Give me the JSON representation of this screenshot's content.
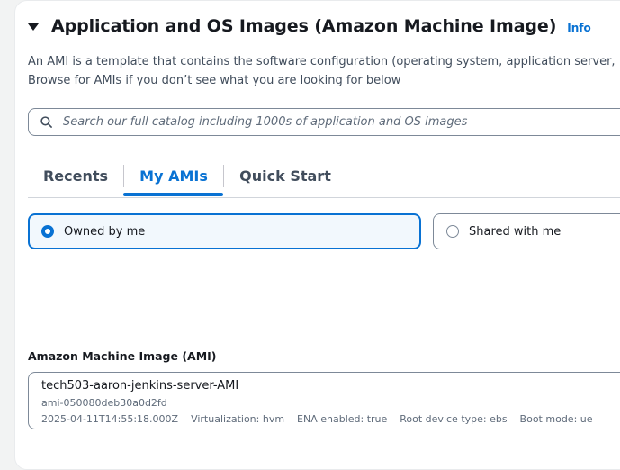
{
  "section": {
    "title": "Application and OS Images (Amazon Machine Image)",
    "info_label": "Info",
    "description_line1": "An AMI is a template that contains the software configuration (operating system, application server,",
    "description_line2": "Browse for AMIs if you don’t see what you are looking for below"
  },
  "search": {
    "placeholder": "Search our full catalog including 1000s of application and OS images",
    "value": ""
  },
  "tabs": [
    {
      "label": "Recents",
      "selected": false
    },
    {
      "label": "My AMIs",
      "selected": true
    },
    {
      "label": "Quick Start",
      "selected": false
    }
  ],
  "ownership": {
    "options": [
      {
        "label": "Owned by me",
        "selected": true
      },
      {
        "label": "Shared with me",
        "selected": false
      }
    ]
  },
  "ami": {
    "label": "Amazon Machine Image (AMI)",
    "name": "tech503-aaron-jenkins-server-AMI",
    "id": "ami-050080deb30a0d2fd",
    "meta": "2025-04-11T14:55:18.000Z    Virtualization: hvm    ENA enabled: true    Root device type: ebs    Boot mode: ue"
  },
  "colors": {
    "accent": "#0972d3",
    "text": "#16191f",
    "secondary_text": "#5f6b7a",
    "border": "#7d8998",
    "page_background": "#f2f3f3",
    "selected_tile_background": "#f2f8fd"
  },
  "icons": {
    "collapse": "caret-down-icon",
    "search": "search-icon"
  }
}
